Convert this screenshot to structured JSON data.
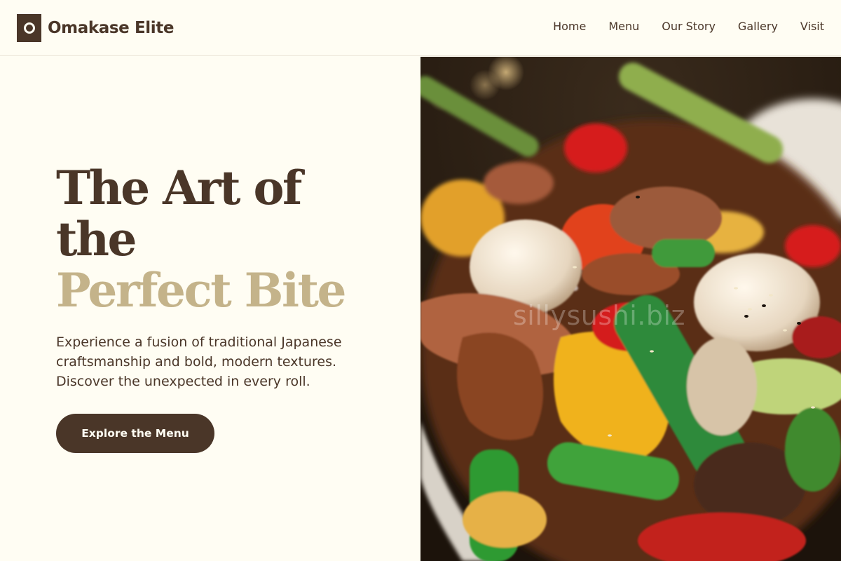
{
  "brand": {
    "name": "Omakase Elite",
    "logo_icon": "ring-logo-icon",
    "color": "#4a3628",
    "accent": "#c4b38a",
    "background": "#fffdf3"
  },
  "nav": {
    "items": [
      {
        "label": "Home"
      },
      {
        "label": "Menu"
      },
      {
        "label": "Our Story"
      },
      {
        "label": "Gallery"
      },
      {
        "label": "Visit"
      }
    ]
  },
  "hero": {
    "title_line1": "The Art of",
    "title_line2": "the",
    "title_accent": "Perfect Bite",
    "description": "Experience a fusion of traditional Japanese craftsmanship and bold, modern textures. Discover the unexpected in every roll.",
    "cta_label": "Explore the Menu",
    "image_alt": "stir-fry dish with quail eggs, peppers and meat",
    "watermark": "sillysushi.biz"
  }
}
